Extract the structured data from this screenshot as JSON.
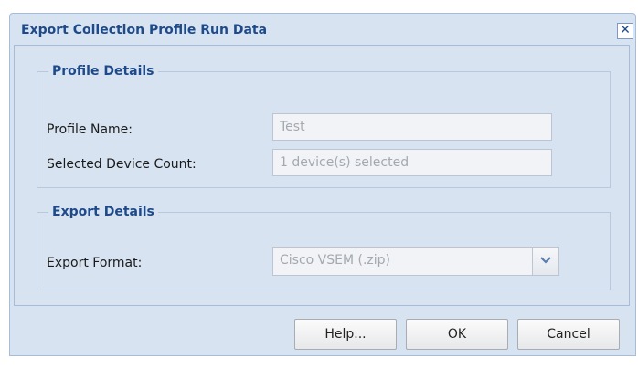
{
  "dialog": {
    "title": "Export Collection Profile Run Data",
    "close_glyph": "✕"
  },
  "profile_details": {
    "legend": "Profile Details",
    "profile_name_label": "Profile Name:",
    "profile_name_value": "Test",
    "device_count_label": "Selected Device Count:",
    "device_count_value": "1 device(s) selected"
  },
  "export_details": {
    "legend": "Export Details",
    "format_label": "Export Format:",
    "format_value": "Cisco VSEM (.zip)"
  },
  "buttons": {
    "help": "Help...",
    "ok": "OK",
    "cancel": "Cancel"
  },
  "colors": {
    "accent": "#1e4a89",
    "dialog_bg": "#d7e3f1",
    "disabled_text": "#a4a9b0"
  }
}
